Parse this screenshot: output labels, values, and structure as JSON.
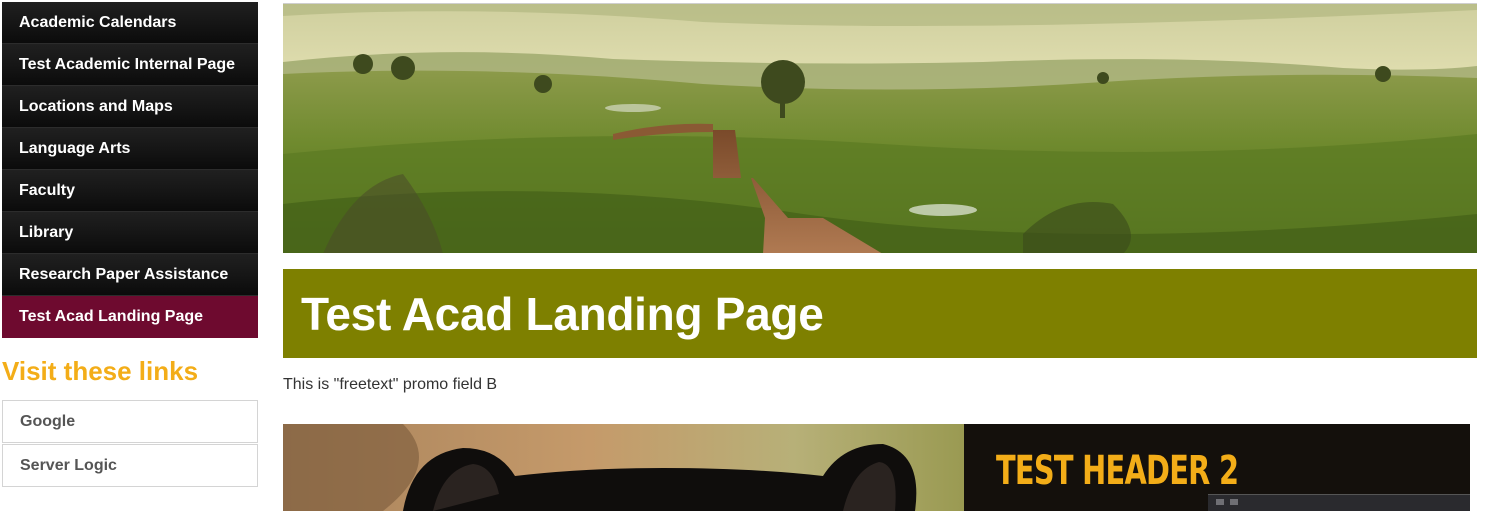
{
  "nav": {
    "items": [
      {
        "label": "Academic Calendars",
        "active": false
      },
      {
        "label": "Test Academic Internal Page",
        "active": false
      },
      {
        "label": "Locations and Maps",
        "active": false
      },
      {
        "label": "Language Arts",
        "active": false
      },
      {
        "label": "Faculty",
        "active": false
      },
      {
        "label": "Library",
        "active": false
      },
      {
        "label": "Research Paper Assistance",
        "active": false
      },
      {
        "label": "Test Acad Landing Page",
        "active": true
      }
    ]
  },
  "links_section": {
    "title": "Visit these links",
    "links": [
      "Google",
      "Server Logic"
    ]
  },
  "main": {
    "page_title": "Test Acad Landing Page",
    "promo_text": "This is \"freetext\" promo field B",
    "promo_header": "TEST HEADER 2"
  },
  "colors": {
    "nav_active": "#6e0a2f",
    "title_bar": "#7e8000",
    "accent_orange": "#f3ad18"
  }
}
